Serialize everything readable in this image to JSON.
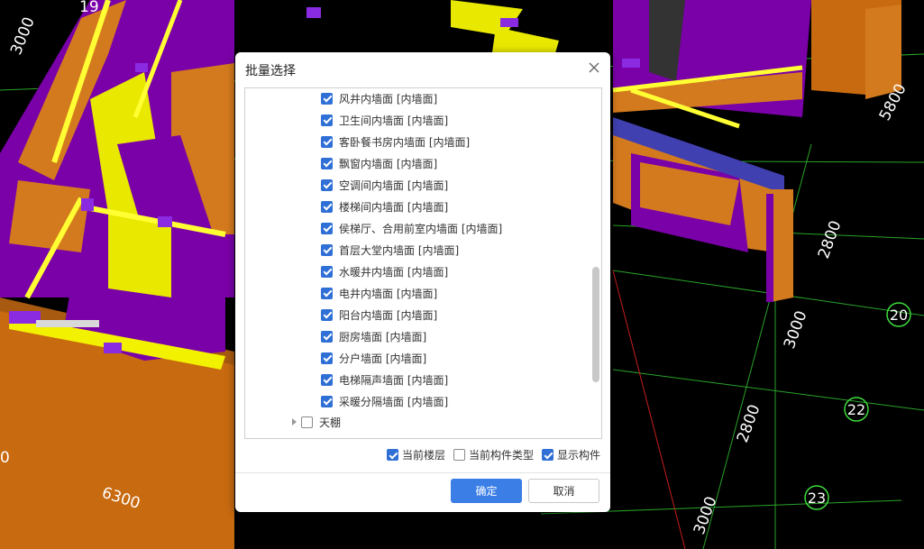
{
  "dialog": {
    "title": "批量选择",
    "close_icon": "close-icon",
    "tree_items": [
      {
        "label": "风井内墙面 [内墙面]",
        "checked": true
      },
      {
        "label": "卫生间内墙面 [内墙面]",
        "checked": true
      },
      {
        "label": "客卧餐书房内墙面 [内墙面]",
        "checked": true
      },
      {
        "label": "飘窗内墙面 [内墙面]",
        "checked": true
      },
      {
        "label": "空调间内墙面 [内墙面]",
        "checked": true
      },
      {
        "label": "楼梯间内墙面 [内墙面]",
        "checked": true
      },
      {
        "label": "侯梯厅、合用前室内墙面 [内墙面]",
        "checked": true
      },
      {
        "label": "首层大堂内墙面 [内墙面]",
        "checked": true
      },
      {
        "label": "水暖井内墙面 [内墙面]",
        "checked": true
      },
      {
        "label": "电井内墙面 [内墙面]",
        "checked": true
      },
      {
        "label": "阳台内墙面 [内墙面]",
        "checked": true
      },
      {
        "label": "厨房墙面 [内墙面]",
        "checked": true
      },
      {
        "label": "分户墙面 [内墙面]",
        "checked": true
      },
      {
        "label": "电梯隔声墙面 [内墙面]",
        "checked": true
      },
      {
        "label": "采暖分隔墙面 [内墙面]",
        "checked": true
      }
    ],
    "collapsed_node": {
      "label": "天棚",
      "checked": false
    },
    "options": {
      "current_floor": {
        "label": "当前楼层",
        "checked": true
      },
      "current_type": {
        "label": "当前构件类型",
        "checked": false
      },
      "show_components": {
        "label": "显示构件",
        "checked": true
      }
    },
    "ok_label": "确定",
    "cancel_label": "取消"
  },
  "background": {
    "dimensions": [
      "3000",
      "19",
      "5800",
      "2800",
      "3000",
      "2800",
      "3000",
      "6300",
      "0"
    ],
    "axis_markers": [
      "20",
      "22",
      "23"
    ]
  },
  "colors": {
    "accent": "#2f6fd6",
    "ok_button": "#3a7ee6",
    "wall_orange": "#d47a1e",
    "wall_purple": "#7a00a8",
    "wall_yellow": "#e8e800",
    "grid_green": "#2fb52f"
  }
}
